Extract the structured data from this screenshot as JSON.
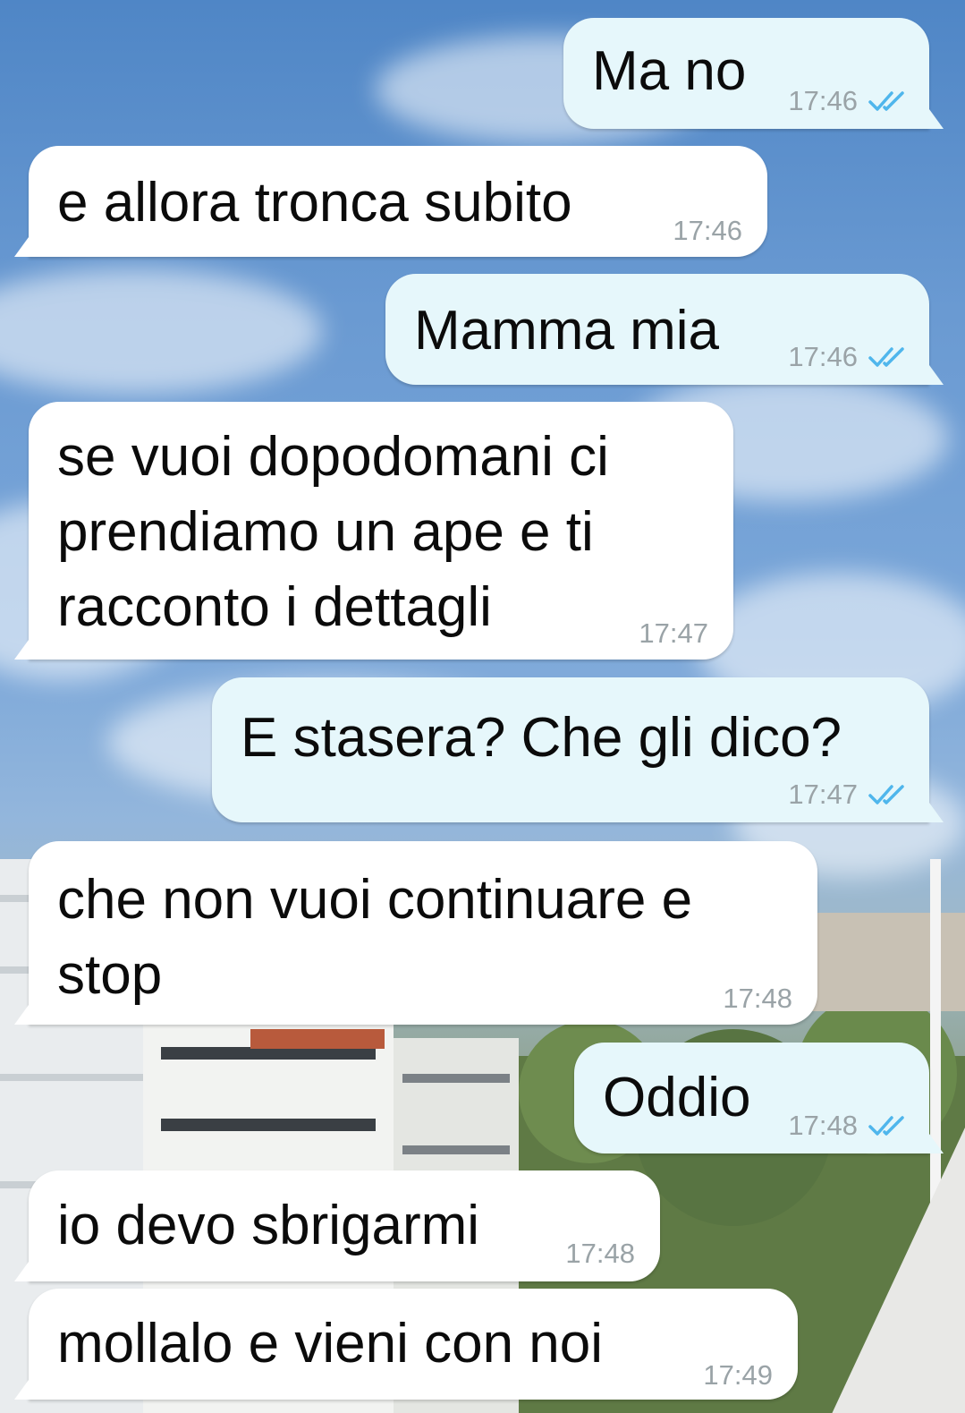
{
  "colors": {
    "incoming_bubble": "#ffffff",
    "outgoing_bubble": "#e6f7fb",
    "timestamp": "#9aa3a7",
    "read_ticks": "#4fb6ec"
  },
  "messages": [
    {
      "direction": "out",
      "text": "Ma no",
      "time": "17:46",
      "status_icon": "double-check-read-icon"
    },
    {
      "direction": "in",
      "text": "e allora tronca subito",
      "time": "17:46"
    },
    {
      "direction": "out",
      "text": "Mamma mia",
      "time": "17:46",
      "status_icon": "double-check-read-icon"
    },
    {
      "direction": "in",
      "text": "se vuoi dopodomani ci\nprendiamo un ape e ti\nracconto i dettagli",
      "time": "17:47"
    },
    {
      "direction": "out",
      "text": "E stasera? Che gli dico?",
      "time": "17:47",
      "status_icon": "double-check-read-icon"
    },
    {
      "direction": "in",
      "text": "che non vuoi continuare e\nstop",
      "time": "17:48"
    },
    {
      "direction": "out",
      "text": "Oddio",
      "time": "17:48",
      "status_icon": "double-check-read-icon"
    },
    {
      "direction": "in",
      "text": "io devo sbrigarmi",
      "time": "17:48"
    },
    {
      "direction": "in",
      "text": "mollalo e vieni con noi",
      "time": "17:49"
    }
  ]
}
